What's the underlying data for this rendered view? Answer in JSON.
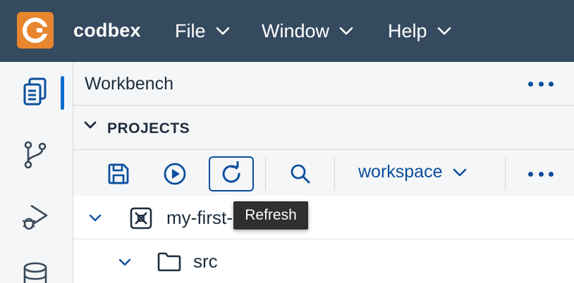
{
  "app": {
    "brand": "codbex"
  },
  "menu": [
    {
      "label": "File"
    },
    {
      "label": "Window"
    },
    {
      "label": "Help"
    }
  ],
  "activity_bar": {
    "items": [
      {
        "icon": "files-icon",
        "active": true
      },
      {
        "icon": "git-branch-icon",
        "active": false
      },
      {
        "icon": "debug-icon",
        "active": false
      },
      {
        "icon": "database-icon",
        "active": false
      }
    ]
  },
  "panel": {
    "title": "Workbench"
  },
  "section": {
    "title": "PROJECTS"
  },
  "toolbar": {
    "buttons": [
      {
        "icon": "save-icon"
      },
      {
        "icon": "run-icon"
      },
      {
        "icon": "refresh-icon",
        "active": true
      },
      {
        "icon": "search-icon"
      }
    ],
    "workspace": "workspace"
  },
  "tooltip": {
    "text": "Refresh"
  },
  "tree": {
    "project": "my-first-project",
    "folder": "src"
  },
  "colors": {
    "header_bg": "#354a5f",
    "logo_bg": "#e8862f",
    "accent": "#0a4f9e",
    "indicator": "#0a6ed1"
  }
}
